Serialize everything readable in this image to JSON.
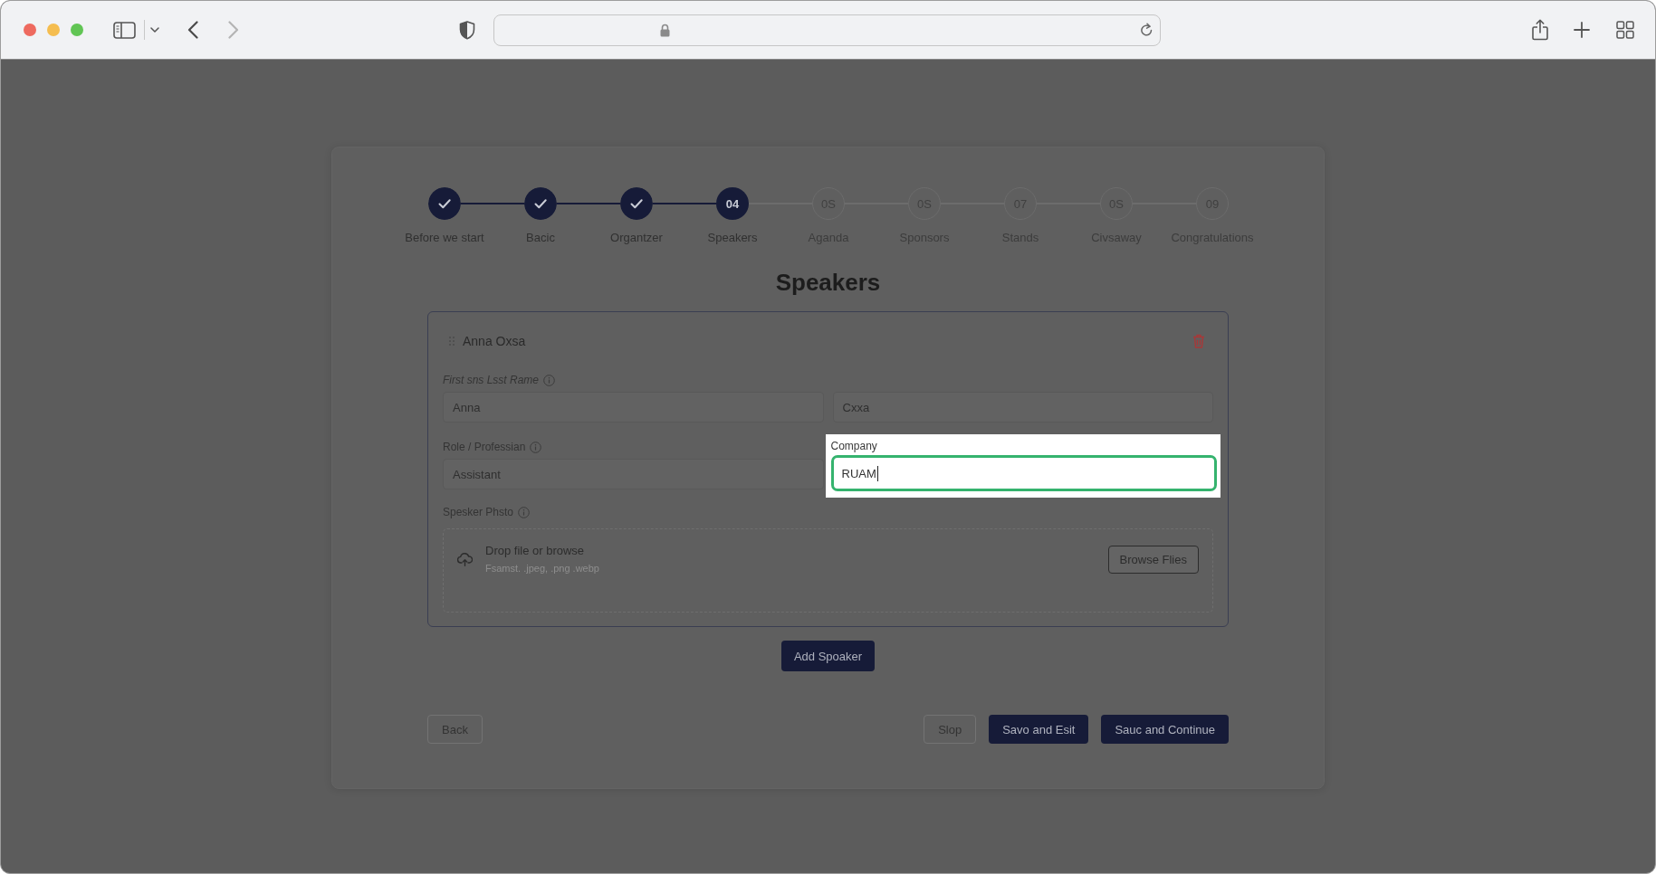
{
  "browser": {
    "back_enabled": true,
    "forward_enabled": false
  },
  "stepper": {
    "steps": [
      {
        "label": "Before we start",
        "kind": "done"
      },
      {
        "label": "Bacic",
        "kind": "done"
      },
      {
        "label": "Organtzer",
        "kind": "done"
      },
      {
        "number": "04",
        "label": "Speakers",
        "kind": "current"
      },
      {
        "number": "0S",
        "label": "Aganda",
        "kind": "upcoming"
      },
      {
        "number": "0S",
        "label": "Sponsors",
        "kind": "upcoming"
      },
      {
        "number": "07",
        "label": "Stands",
        "kind": "upcoming"
      },
      {
        "number": "0S",
        "label": "Civsaway",
        "kind": "upcoming"
      },
      {
        "number": "09",
        "label": "Congratulations",
        "kind": "upcoming"
      }
    ]
  },
  "title": "Speakers",
  "speaker": {
    "name": "Anna Oxsa",
    "name_label": "First sns Lsst Rame",
    "first_name": "Anna",
    "last_name": "Cxxa",
    "role_label": "Role / Professian",
    "role": "Assistant",
    "company": {
      "label": "Company",
      "value": "RUAM",
      "focused": true
    },
    "photo": {
      "label": "Spesker Phsto",
      "prompt": "Drop file or browse",
      "formats": "Fsamst. .jpeg, .png .webp",
      "button": "Browse Flies"
    }
  },
  "add_button": "Add Spoaker",
  "footer": {
    "back": "Back",
    "skip": "Slop",
    "save_exit": "Savo and Esit",
    "save_continue": "Sauc and Continue"
  }
}
